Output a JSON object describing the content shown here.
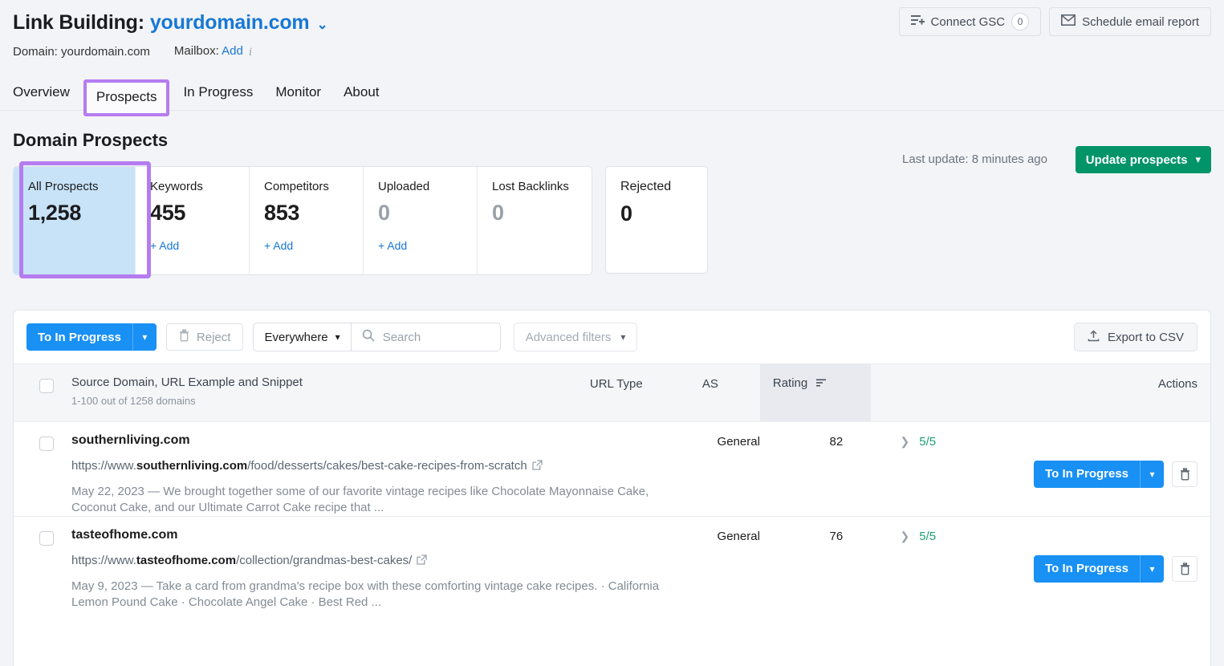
{
  "header": {
    "title_prefix": "Link Building:",
    "domain": "yourdomain.com",
    "domain_caret": "⌄",
    "meta_domain": "Domain: yourdomain.com",
    "meta_mailbox_label": "Mailbox:",
    "meta_mailbox_link": "Add",
    "info_icon_glyph": "i",
    "connect_gsc_label": "Connect GSC",
    "connect_gsc_count": "0",
    "schedule_email_label": "Schedule email report"
  },
  "tabs": [
    {
      "label": "Overview",
      "active": false
    },
    {
      "label": "Prospects",
      "active": true
    },
    {
      "label": "In Progress",
      "active": false
    },
    {
      "label": "Monitor",
      "active": false
    },
    {
      "label": "About",
      "active": false
    }
  ],
  "section": {
    "title": "Domain Prospects",
    "last_update": "Last update: 8 minutes ago",
    "update_button": "Update prospects"
  },
  "cards": [
    {
      "label": "All Prospects",
      "value": "1,258",
      "add": "",
      "zero": false,
      "selected": true
    },
    {
      "label": "Keywords",
      "value": "455",
      "add": "+ Add",
      "zero": false,
      "selected": false
    },
    {
      "label": "Competitors",
      "value": "853",
      "add": "+ Add",
      "zero": false,
      "selected": false
    },
    {
      "label": "Uploaded",
      "value": "0",
      "add": "+ Add",
      "zero": true,
      "selected": false
    },
    {
      "label": "Lost Backlinks",
      "value": "0",
      "add": "",
      "zero": true,
      "selected": false
    }
  ],
  "card_rejected": {
    "label": "Rejected",
    "value": "0"
  },
  "toolbar": {
    "to_in_progress_label": "To In Progress",
    "reject_label": "Reject",
    "scope_value": "Everywhere",
    "search_placeholder": "Search",
    "search_value": "",
    "advanced_filters_label": "Advanced filters",
    "export_label": "Export to CSV"
  },
  "table": {
    "col_main_header": "Source Domain, URL Example and Snippet",
    "col_main_sub": "1-100 out of 1258 domains",
    "col_urltype_header": "URL Type",
    "col_as_header": "AS",
    "col_rating_header": "Rating",
    "col_actions_header": "Actions",
    "rows": [
      {
        "domain": "southernliving.com",
        "url_prefix": "https://www.",
        "url_bold": "southernliving.com",
        "url_suffix": "/food/desserts/cakes/best-cake-recipes-from-scratch",
        "snippet": "May 22, 2023 — We brought together some of our favorite vintage recipes like Chocolate Mayonnaise Cake, Coconut Cake, and our Ultimate Carrot Cake recipe that ...",
        "url_type": "General",
        "as": "82",
        "rating": "5/5",
        "action_label": "To In Progress"
      },
      {
        "domain": "tasteofhome.com",
        "url_prefix": "https://www.",
        "url_bold": "tasteofhome.com",
        "url_suffix": "/collection/grandmas-best-cakes/",
        "snippet": "May 9, 2023 — Take a card from grandma's recipe box with these comforting vintage cake recipes. · California Lemon Pound Cake · Chocolate Angel Cake · Best Red ...",
        "url_type": "General",
        "as": "76",
        "rating": "5/5",
        "action_label": "To In Progress"
      }
    ]
  },
  "colors": {
    "annotation_purple": "#b57cf0",
    "selected_card_blue": "#c8e3f8",
    "link_blue": "#1878d4",
    "primary_blue": "#1890f4",
    "green": "#029469",
    "rating_green": "#1e9e78",
    "page_bg": "#f3f4f7"
  }
}
